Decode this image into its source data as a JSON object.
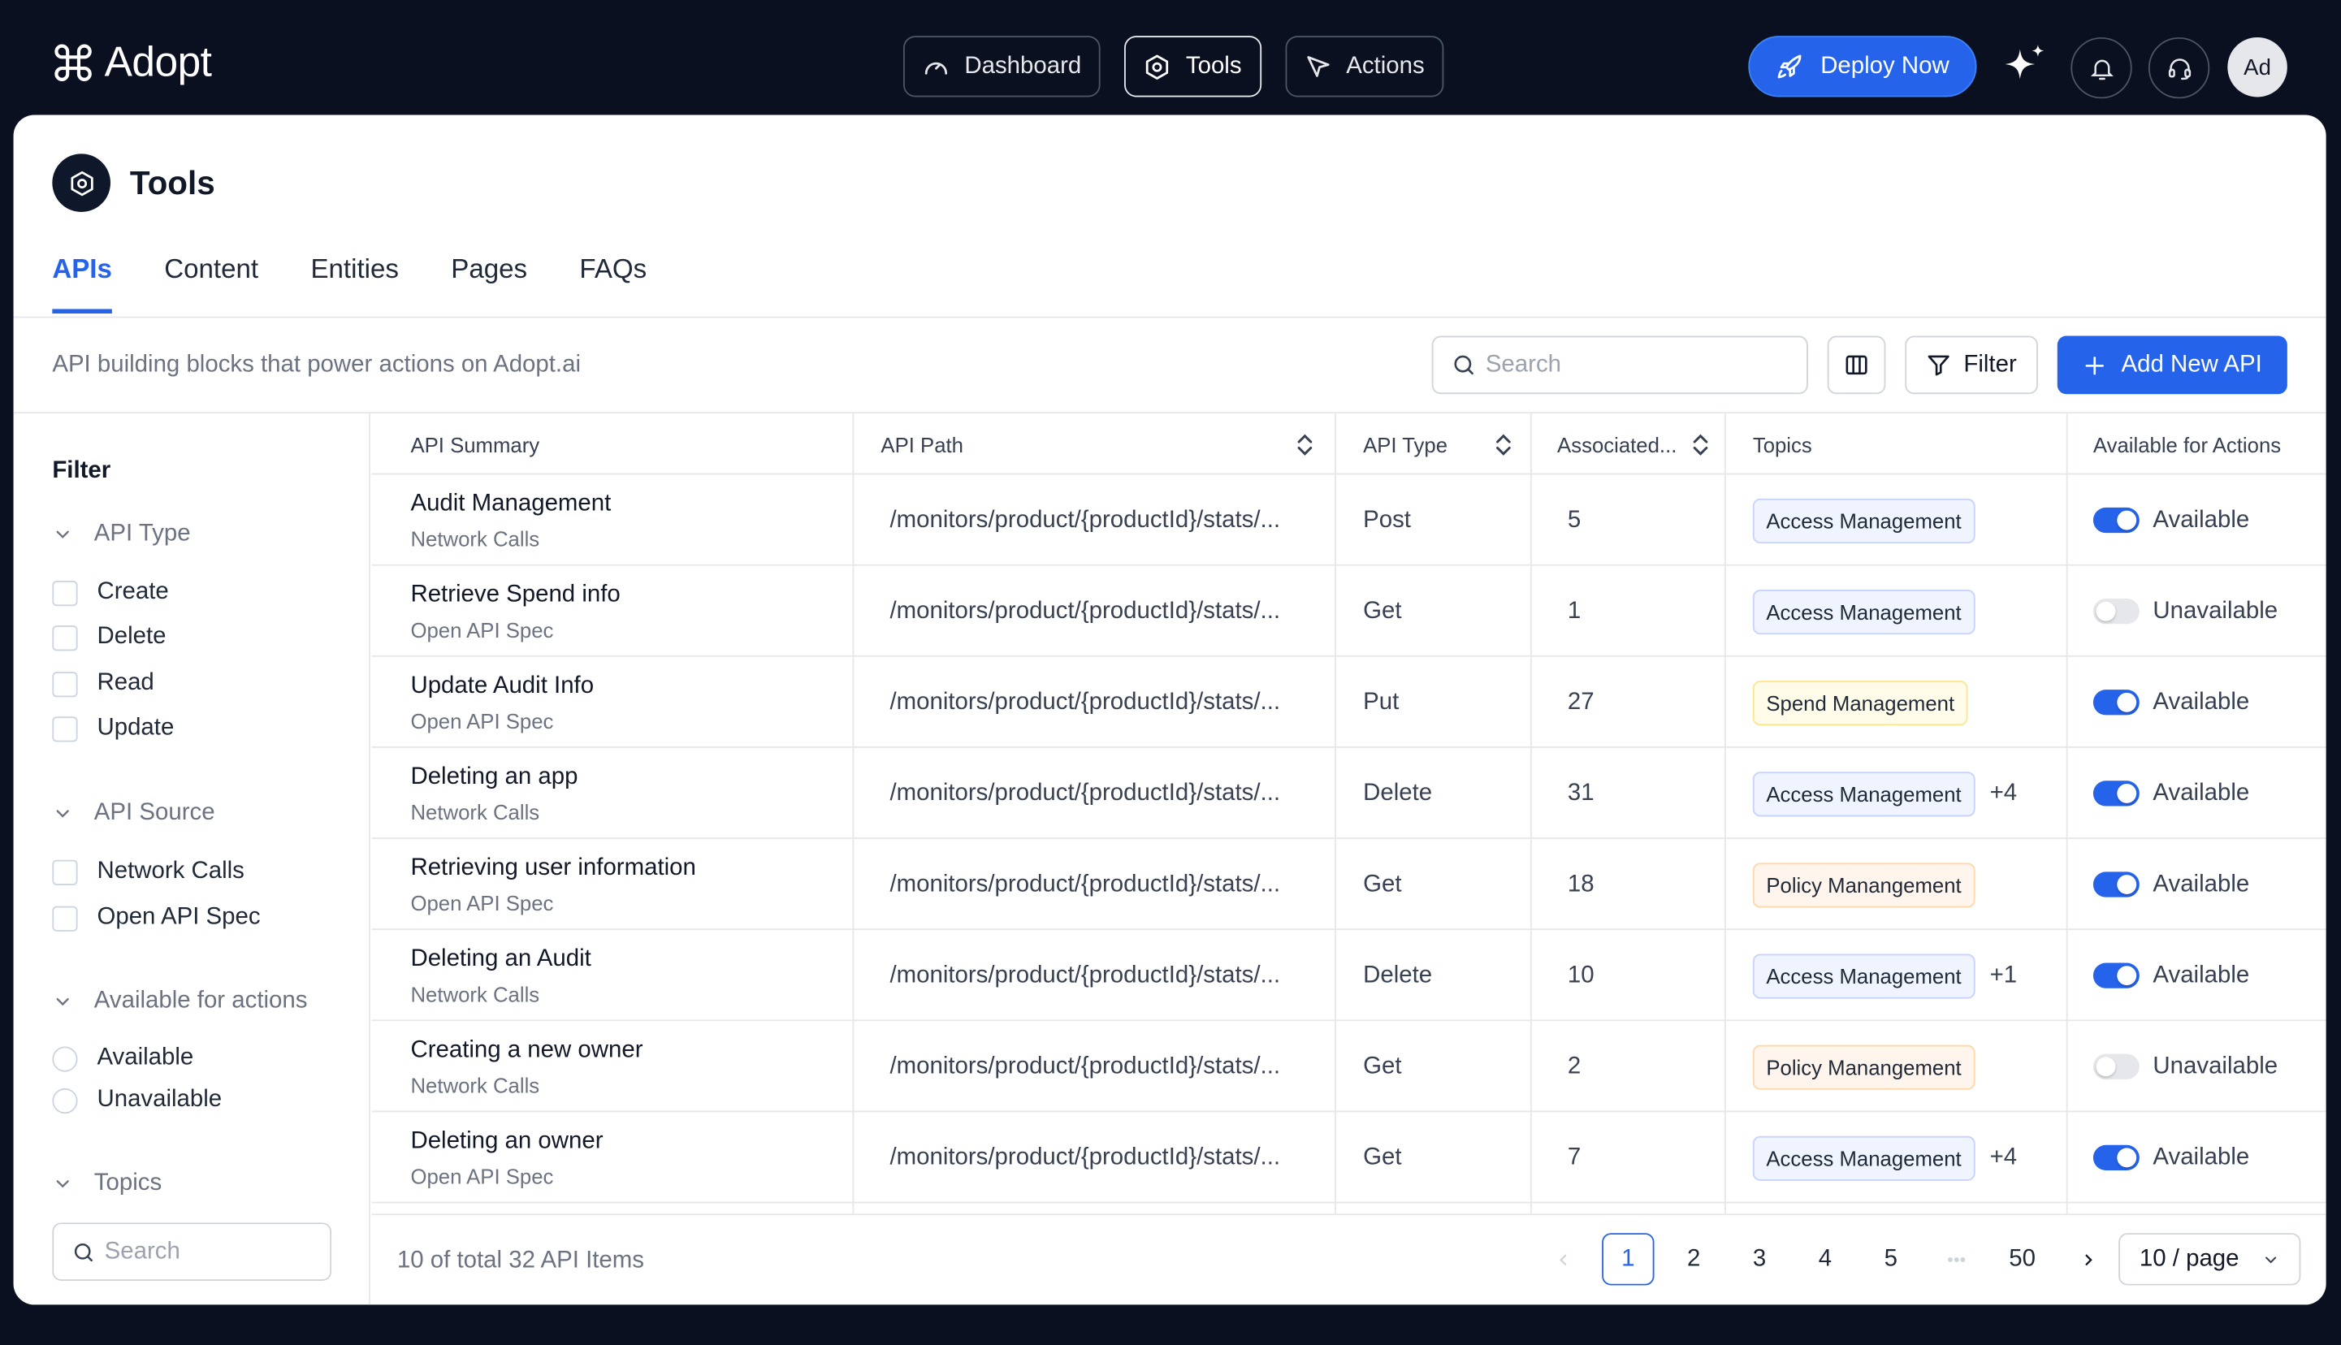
{
  "app": {
    "name": "Adopt"
  },
  "topnav": {
    "items": [
      {
        "label": "Dashboard",
        "icon": "gauge-icon"
      },
      {
        "label": "Tools",
        "icon": "hexagon-icon"
      },
      {
        "label": "Actions",
        "icon": "cursor-icon"
      }
    ],
    "active": "Tools",
    "deploy_label": "Deploy Now",
    "avatar_initials": "Ad"
  },
  "page": {
    "title": "Tools",
    "tabs": [
      "APIs",
      "Content",
      "Entities",
      "Pages",
      "FAQs"
    ],
    "active_tab": "APIs",
    "description": "API building blocks that power actions on Adopt.ai"
  },
  "toolbar": {
    "search_placeholder": "Search",
    "filter_label": "Filter",
    "add_label": "Add New API"
  },
  "sidebar": {
    "title": "Filter",
    "groups": [
      {
        "label": "API Type",
        "options": [
          "Create",
          "Delete",
          "Read",
          "Update"
        ]
      },
      {
        "label": "API Source",
        "options": [
          "Network Calls",
          "Open API Spec"
        ]
      },
      {
        "label": "Available for actions",
        "options": [
          "Available",
          "Unavailable"
        ]
      },
      {
        "label": "Topics",
        "options": []
      }
    ],
    "search_placeholder": "Search"
  },
  "table": {
    "headers": [
      "API Summary",
      "API Path",
      "API Type",
      "Associated...",
      "Topics",
      "Available for Actions"
    ],
    "rows": [
      {
        "summary": "Audit Management",
        "source": "Network Calls",
        "path": "/monitors/product/{productId}/stats/...",
        "type": "Post",
        "assoc": "5",
        "topic": "Access Management",
        "topic_kind": "access",
        "more": "",
        "available": true,
        "avail_label": "Available"
      },
      {
        "summary": "Retrieve Spend info",
        "source": "Open API Spec",
        "path": "/monitors/product/{productId}/stats/...",
        "type": "Get",
        "assoc": "1",
        "topic": "Access Management",
        "topic_kind": "access",
        "more": "",
        "available": false,
        "avail_label": "Unavailable"
      },
      {
        "summary": "Update Audit Info",
        "source": "Open API Spec",
        "path": "/monitors/product/{productId}/stats/...",
        "type": "Put",
        "assoc": "27",
        "topic": "Spend Management",
        "topic_kind": "spend",
        "more": "",
        "available": true,
        "avail_label": "Available"
      },
      {
        "summary": "Deleting an app",
        "source": "Network Calls",
        "path": "/monitors/product/{productId}/stats/...",
        "type": "Delete",
        "assoc": "31",
        "topic": "Access Management",
        "topic_kind": "access",
        "more": "+4",
        "available": true,
        "avail_label": "Available"
      },
      {
        "summary": "Retrieving user information",
        "source": "Open API Spec",
        "path": "/monitors/product/{productId}/stats/...",
        "type": "Get",
        "assoc": "18",
        "topic": "Policy Manangement",
        "topic_kind": "policy",
        "more": "",
        "available": true,
        "avail_label": "Available"
      },
      {
        "summary": "Deleting an Audit",
        "source": "Network Calls",
        "path": "/monitors/product/{productId}/stats/...",
        "type": "Delete",
        "assoc": "10",
        "topic": "Access Management",
        "topic_kind": "access",
        "more": "+1",
        "available": true,
        "avail_label": "Available"
      },
      {
        "summary": "Creating a new owner",
        "source": "Network Calls",
        "path": "/monitors/product/{productId}/stats/...",
        "type": "Get",
        "assoc": "2",
        "topic": "Policy Manangement",
        "topic_kind": "policy",
        "more": "",
        "available": false,
        "avail_label": "Unavailable"
      },
      {
        "summary": "Deleting an owner",
        "source": "Open API Spec",
        "path": "/monitors/product/{productId}/stats/...",
        "type": "Get",
        "assoc": "7",
        "topic": "Access Management",
        "topic_kind": "access",
        "more": "+4",
        "available": true,
        "avail_label": "Available"
      }
    ]
  },
  "footer": {
    "total_text": "10 of total 32 API Items",
    "pages": [
      "1",
      "2",
      "3",
      "4",
      "5",
      "•••",
      "50"
    ],
    "current_page": "1",
    "page_size": "10 / page"
  },
  "colors": {
    "accent": "#2563eb",
    "topbar": "#0b1020"
  }
}
